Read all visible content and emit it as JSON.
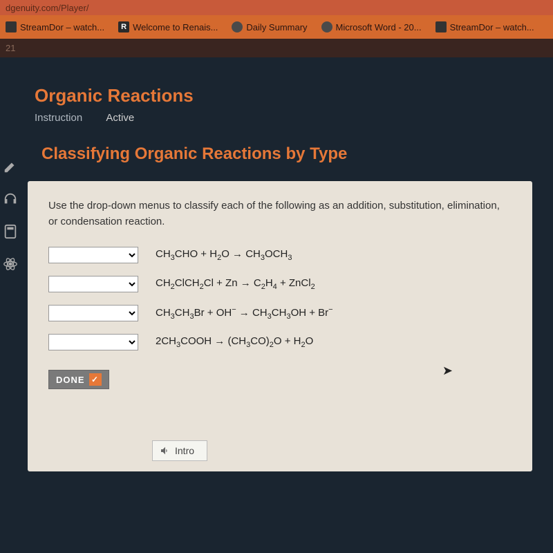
{
  "url": "dgenuity.com/Player/",
  "bookmarks": [
    {
      "label": "StreamDor – watch..."
    },
    {
      "label": "Welcome to Renais..."
    },
    {
      "label": "Daily Summary"
    },
    {
      "label": "Microsoft Word - 20..."
    },
    {
      "label": "StreamDor – watch..."
    }
  ],
  "topIndicator": "21",
  "lesson": {
    "title": "Organic Reactions",
    "instruction": "Instruction",
    "status": "Active"
  },
  "content": {
    "title": "Classifying Organic Reactions by Type",
    "instructions": "Use the drop-down menus to classify each of the following as an addition, substitution, elimination, or condensation reaction.",
    "reactions": [
      "CH₃CHO + H₂O → CH₃OCH₃",
      "CH₂ClCH₂Cl + Zn → C₂H₄ + ZnCl₂",
      "CH₃CH₃Br + OH⁻ → CH₃CH₃OH + Br⁻",
      "2CH₃COOH → (CH₃CO)₂O + H₂O"
    ],
    "doneLabel": "DONE",
    "introLabel": "Intro"
  }
}
